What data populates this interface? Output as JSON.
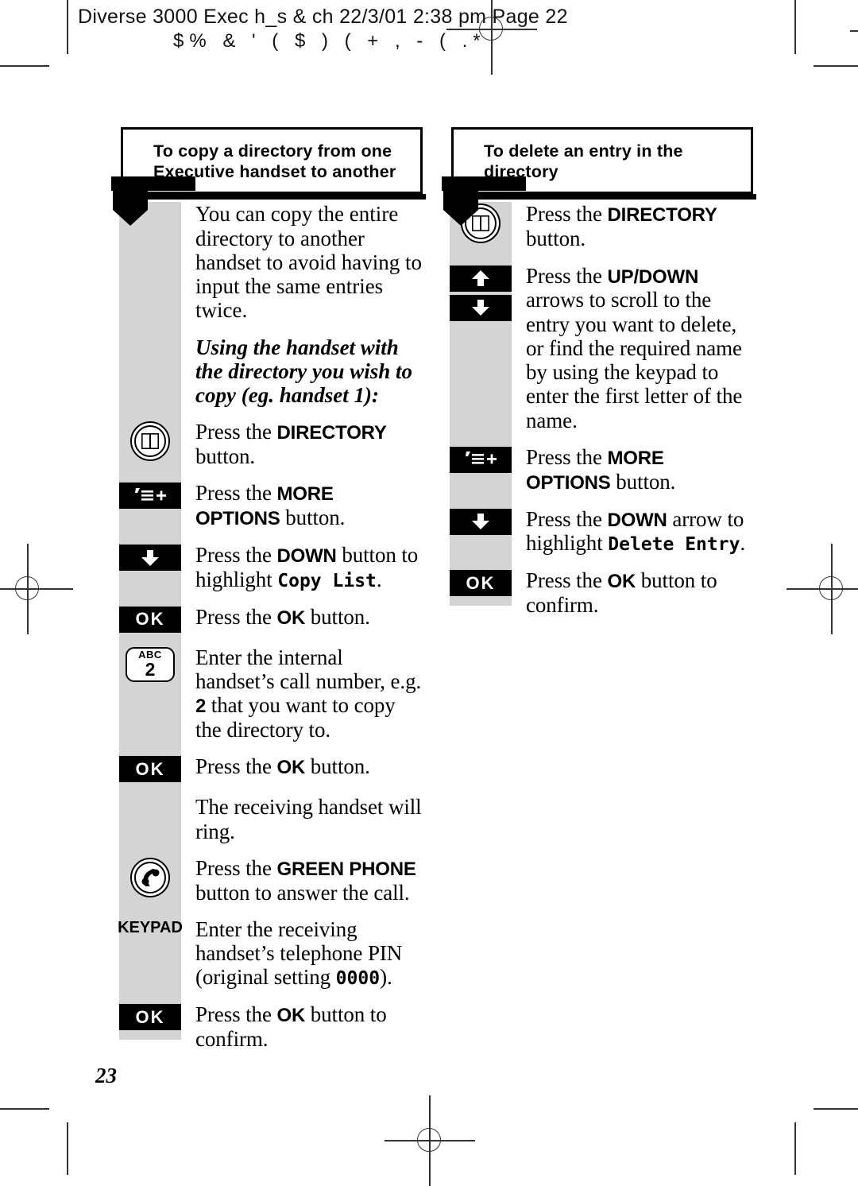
{
  "film_header": {
    "line1": "Diverse 3000 Exec h_s & ch  22/3/01  2:38 pm  Page 22",
    "line2": "$%      &   '      ( $      )  (  + ,  -  (  .*"
  },
  "page_number": "23",
  "columns": [
    {
      "id": "copy-directory",
      "heading": "To copy a directory from one Executive handset to another",
      "blocks": [
        {
          "kind": "paragraph",
          "style": "roman",
          "text": "You can copy the entire directory to another handset to avoid having to input the same entries twice."
        },
        {
          "kind": "paragraph",
          "style": "italic",
          "text": "Using the handset with the directory you wish to copy (eg. handset 1):"
        },
        {
          "kind": "step",
          "icon": "directory-book-icon",
          "icon_label": "",
          "text_parts": [
            {
              "t": "Press the ",
              "s": "n"
            },
            {
              "t": "DIRECTORY",
              "s": "b"
            },
            {
              "t": " button.",
              "s": "n"
            }
          ]
        },
        {
          "kind": "step",
          "icon": "more-options-icon",
          "icon_label": "’≡+",
          "text_parts": [
            {
              "t": "Press the ",
              "s": "n"
            },
            {
              "t": "MORE OPTIONS",
              "s": "b"
            },
            {
              "t": " button.",
              "s": "n"
            }
          ]
        },
        {
          "kind": "step",
          "icon": "down-arrow-icon",
          "icon_label": "",
          "text_parts": [
            {
              "t": "Press the ",
              "s": "n"
            },
            {
              "t": "DOWN",
              "s": "b"
            },
            {
              "t": " button to highlight ",
              "s": "n"
            },
            {
              "t": "Copy List",
              "s": "lcd"
            },
            {
              "t": ".",
              "s": "n"
            }
          ]
        },
        {
          "kind": "step",
          "icon": "ok-button-icon",
          "icon_label": "OK",
          "text_parts": [
            {
              "t": "Press the ",
              "s": "n"
            },
            {
              "t": "OK",
              "s": "b"
            },
            {
              "t": " button.",
              "s": "n"
            }
          ]
        },
        {
          "kind": "step",
          "icon": "keypad-2-icon",
          "icon_label": "ABC 2",
          "text_parts": [
            {
              "t": "Enter the internal handset’s call number, e.g. ",
              "s": "n"
            },
            {
              "t": "2",
              "s": "b"
            },
            {
              "t": " that you want to copy the directory to.",
              "s": "n"
            }
          ]
        },
        {
          "kind": "step",
          "icon": "ok-button-icon",
          "icon_label": "OK",
          "text_parts": [
            {
              "t": "Press the ",
              "s": "n"
            },
            {
              "t": "OK",
              "s": "b"
            },
            {
              "t": " button.",
              "s": "n"
            }
          ]
        },
        {
          "kind": "step",
          "icon": "none",
          "icon_label": "",
          "text_parts": [
            {
              "t": "The receiving handset will ring.",
              "s": "n"
            }
          ]
        },
        {
          "kind": "step",
          "icon": "green-phone-icon",
          "icon_label": "",
          "text_parts": [
            {
              "t": "Press the ",
              "s": "n"
            },
            {
              "t": "GREEN PHONE",
              "s": "b"
            },
            {
              "t": " button to answer the call.",
              "s": "n"
            }
          ]
        },
        {
          "kind": "step",
          "icon": "keypad-word-icon",
          "icon_label": "KEYPAD",
          "text_parts": [
            {
              "t": "Enter the receiving handset’s telephone PIN (original setting ",
              "s": "n"
            },
            {
              "t": "0000",
              "s": "lcd"
            },
            {
              "t": ").",
              "s": "n"
            }
          ]
        },
        {
          "kind": "step",
          "icon": "ok-button-icon",
          "icon_label": "OK",
          "text_parts": [
            {
              "t": "Press the ",
              "s": "n"
            },
            {
              "t": "OK",
              "s": "b"
            },
            {
              "t": " button to confirm.",
              "s": "n"
            }
          ]
        }
      ]
    },
    {
      "id": "delete-entry",
      "heading": "To delete an entry in the directory",
      "blocks": [
        {
          "kind": "step",
          "icon": "directory-book-icon",
          "icon_label": "",
          "text_parts": [
            {
              "t": "Press the ",
              "s": "n"
            },
            {
              "t": "DIRECTORY",
              "s": "b"
            },
            {
              "t": " button.",
              "s": "n"
            }
          ]
        },
        {
          "kind": "step",
          "icon": "up-down-arrows-icon",
          "icon_label": "",
          "text_parts": [
            {
              "t": "Press the ",
              "s": "n"
            },
            {
              "t": "UP/DOWN",
              "s": "b"
            },
            {
              "t": " arrows to scroll to the entry you want to delete, or find the required name by using the keypad to enter the first letter of the name.",
              "s": "n"
            }
          ]
        },
        {
          "kind": "step",
          "icon": "more-options-icon",
          "icon_label": "’≡+",
          "text_parts": [
            {
              "t": "Press the ",
              "s": "n"
            },
            {
              "t": "MORE OPTIONS",
              "s": "b"
            },
            {
              "t": " button.",
              "s": "n"
            }
          ]
        },
        {
          "kind": "step",
          "icon": "down-arrow-icon",
          "icon_label": "",
          "text_parts": [
            {
              "t": "Press the ",
              "s": "n"
            },
            {
              "t": "DOWN",
              "s": "b"
            },
            {
              "t": " arrow to highlight ",
              "s": "n"
            },
            {
              "t": "Delete Entry",
              "s": "lcd"
            },
            {
              "t": ".",
              "s": "n"
            }
          ]
        },
        {
          "kind": "step",
          "icon": "ok-button-icon",
          "icon_label": "OK",
          "text_parts": [
            {
              "t": "Press the ",
              "s": "n"
            },
            {
              "t": "OK",
              "s": "b"
            },
            {
              "t": " button to confirm.",
              "s": "n"
            }
          ]
        }
      ]
    }
  ]
}
